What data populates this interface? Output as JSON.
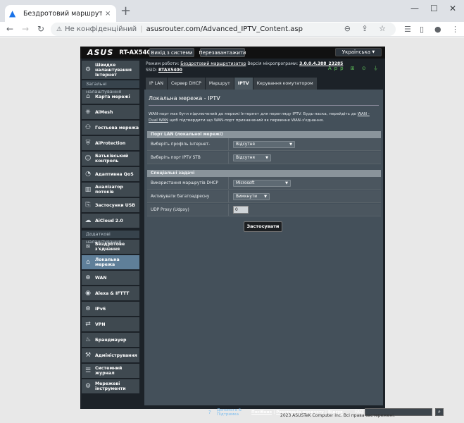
{
  "browser": {
    "tab_title": "Бездротовий маршрутизатор AS",
    "tab_close": "×",
    "new_tab": "+",
    "window_min": "—",
    "window_max": "☐",
    "window_close": "✕",
    "back": "←",
    "forward": "→",
    "reload": "↻",
    "insecure_label": "Не конфіденційний",
    "separator": "|",
    "url": "asusrouter.com/Advanced_IPTV_Content.asp",
    "omni_tools": "⊖ ⇪ ☆",
    "menu": "⋮"
  },
  "router": {
    "logo": "ASUS",
    "model": "RT-AX5400",
    "logout": "Вихід з системи",
    "reboot": "Перезавантажити",
    "language": "Українська",
    "info": {
      "mode_label": "Режим роботи:",
      "mode_value": "Бездротовий маршрутизатор",
      "fw_label": "Версія мікропрограми:",
      "fw_value": "3.0.0.4.388_23285",
      "ssid_label": "SSID:",
      "ssid_value": "RTAX5400",
      "status_icons": "App ⊞ ⊙ ⏚"
    },
    "sidebar": {
      "general_header": "Загальні налаштування",
      "advanced_header": "Додаткові налаштування",
      "quick": {
        "label": "Швидке налаштування Інтернет",
        "icon": "⚙"
      },
      "general_items": [
        {
          "label": "Карта мережі",
          "icon": "⌂"
        },
        {
          "label": "AiMesh",
          "icon": "⎈"
        },
        {
          "label": "Гостьова мережа",
          "icon": "⚇"
        },
        {
          "label": "AiProtection",
          "icon": "⛨"
        },
        {
          "label": "Батьківський контроль",
          "icon": "☺"
        },
        {
          "label": "Адаптивна QoS",
          "icon": "◔"
        },
        {
          "label": "Аналізатор потоків",
          "icon": "▥"
        },
        {
          "label": "Застосунки USB",
          "icon": "⎘"
        },
        {
          "label": "AiCloud 2.0",
          "icon": "☁"
        }
      ],
      "advanced_items": [
        {
          "label": "Бездротове з'єднання",
          "icon": "≋"
        },
        {
          "label": "Локальна мережа",
          "icon": "⌂"
        },
        {
          "label": "WAN",
          "icon": "⊕"
        },
        {
          "label": "Alexa & IFTTT",
          "icon": "◉"
        },
        {
          "label": "IPv6",
          "icon": "⊛"
        },
        {
          "label": "VPN",
          "icon": "⇄"
        },
        {
          "label": "Брандмауер",
          "icon": "♨"
        },
        {
          "label": "Адміністрування",
          "icon": "⚒"
        },
        {
          "label": "Системний журнал",
          "icon": "☰"
        },
        {
          "label": "Мережеві інструменти",
          "icon": "⚙"
        }
      ]
    },
    "tabs": [
      "IP LAN",
      "Сервер DHCP",
      "Маршрут",
      "IPTV",
      "Керування комутатором"
    ],
    "panel": {
      "title": "Локальна мережа - IPTV",
      "desc_1": "WAN-порт має бути підключений до мережі Інтернет для перегляду IPTV. Будь-ласка, перейдіть до",
      "desc_link": "WAN - Dual WAN",
      "desc_2": "щоб підтвердити що WAN-порт призначений як первинне WAN-з'єднання.",
      "group1": "Порт LAN (локальної мережі)",
      "isp_label": "Виберіть профіль Інтернет-провайдера",
      "isp_value": "Відсутня",
      "stb_label": "Виберіть порт IPTV STB",
      "stb_value": "Відсутня",
      "group2": "Спеціальні задачі",
      "dhcp_route_label": "Використання маршрутів DHCP",
      "dhcp_route_value": "Microsoft",
      "multicast_label": "Активувати багатоадресну маршрутизацію",
      "multicast_value": "Вимкнути",
      "udpxy_label": "UDP Proxy (Udpxy)",
      "udpxy_value": "0",
      "apply": "Застосувати"
    },
    "footer": {
      "help_1": "Допомога &",
      "help_2": "Підтримка",
      "manual": "Посібник",
      "sep": " | ",
      "register": "Реєстрація продукту",
      "feedback": "Відгук",
      "faq": "FAQ",
      "faq_go": "⌕"
    },
    "copyright": "2023 ASUSTeK Computer Inc. Всі права застережені."
  }
}
